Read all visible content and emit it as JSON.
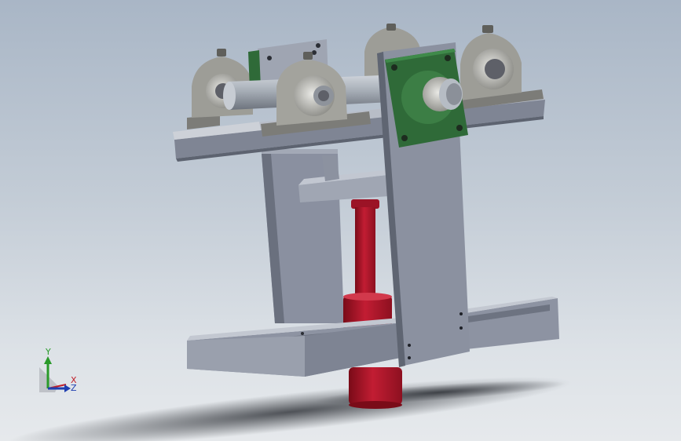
{
  "colors": {
    "background_top": "#a9b6c6",
    "background_bottom": "#e6e9ec",
    "steel": "#8e95a3",
    "steel_dark": "#5d6370",
    "bearing_housing": "#9a9a94",
    "flange_bearing": "#2f6a38",
    "cylinder": "#a8152a",
    "shaft": "#a6adb6"
  },
  "triad": {
    "y_label": "Y",
    "x_label": "X",
    "z_label": "Z",
    "y_color": "#2a9a2a",
    "x_color": "#c0202a",
    "z_color": "#1f3fb0"
  },
  "icons": [
    "coordinate-triad-icon"
  ]
}
